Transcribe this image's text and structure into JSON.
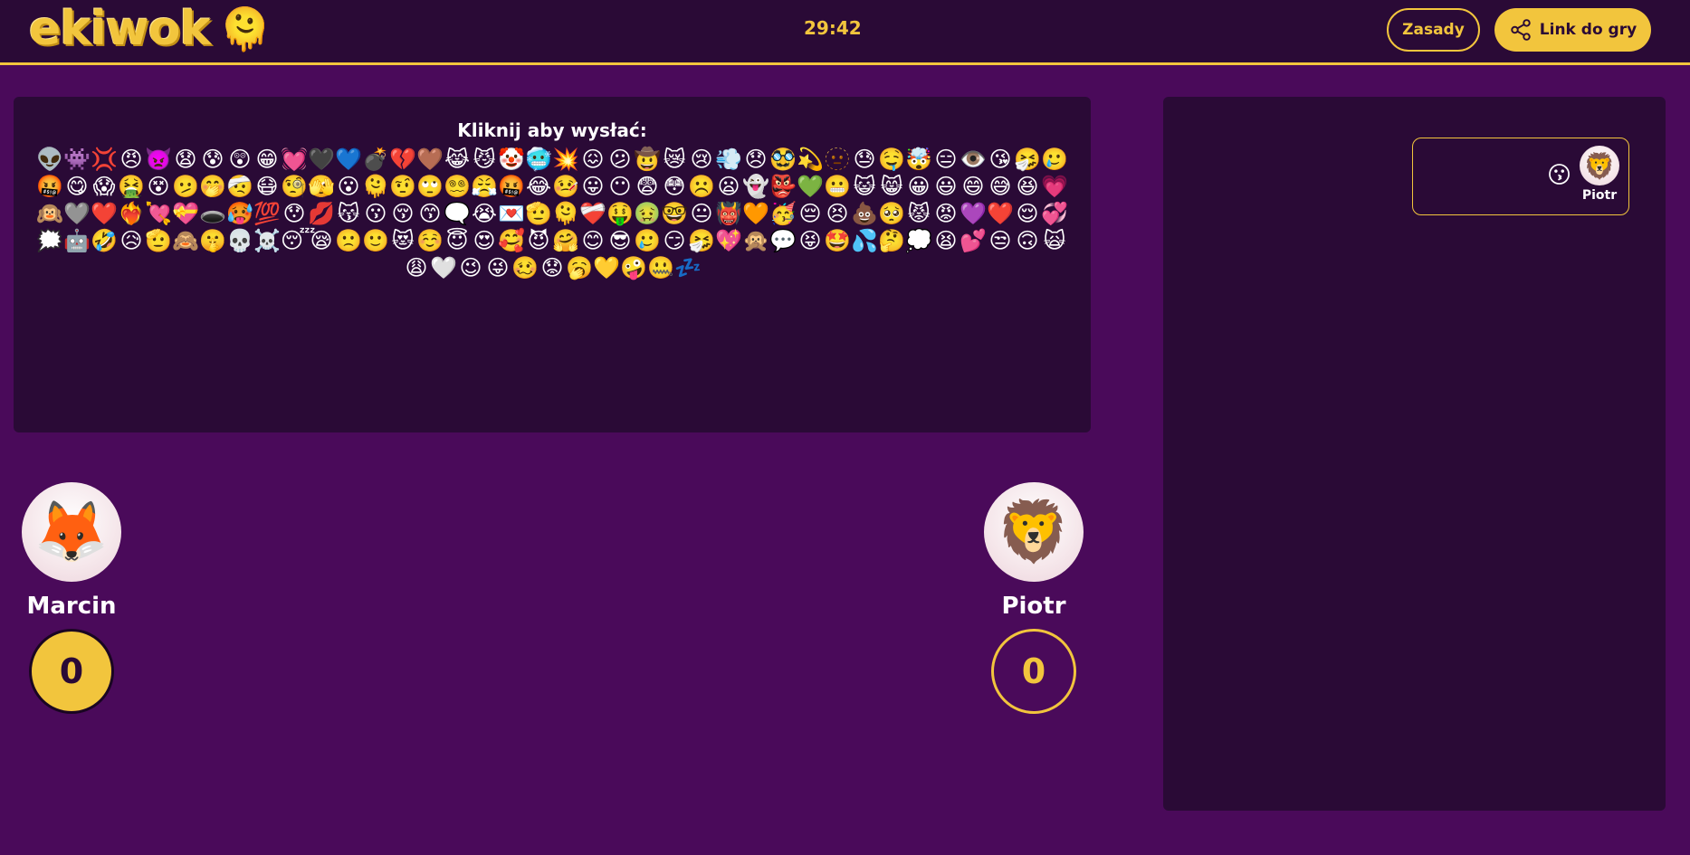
{
  "header": {
    "logo_text": "ekiwok",
    "logo_emoji": "🫠",
    "timer": "29:42",
    "rules_label": "Zasady",
    "link_label": "Link do gry",
    "link_icon": "share-icon"
  },
  "emoji_panel": {
    "title": "Kliknij aby wysłać:",
    "emojis": [
      "👽",
      "👾",
      "💢",
      "😠",
      "👿",
      "😧",
      "😰",
      "😲",
      "😁",
      "💓",
      "🖤",
      "💙",
      "💣",
      "💔",
      "🤎",
      "😹",
      "😼",
      "🤡",
      "🥶",
      "💥",
      "😖",
      "😕",
      "🤠",
      "😿",
      "😢",
      "💨",
      "😞",
      "🥸",
      "💫",
      "🫥",
      "😓",
      "🤤",
      "🤯",
      "😑",
      "👁️",
      "😘",
      "🤧",
      "🥲",
      "🤬",
      "😋",
      "😱",
      "🤮",
      "😵",
      "🫤",
      "🤭",
      "🤕",
      "😷",
      "🧐",
      "🫣",
      "😮",
      "🫠",
      "🤨",
      "🙄",
      "😵‍💫",
      "😤",
      "🤬",
      "😂",
      "🤒",
      "😛",
      "😶",
      "😨",
      "😳",
      "☹️",
      "😦",
      "👻",
      "👺",
      "💚",
      "😬",
      "😺",
      "😸",
      "😀",
      "😃",
      "😄",
      "😅",
      "😆",
      "💗",
      "🙉",
      "🩶",
      "❤️",
      "❤️‍🔥",
      "💘",
      "💝",
      "🕳️",
      "🥵",
      "💯",
      "😯",
      "💋",
      "😽",
      "😗",
      "😚",
      "😙",
      "🗨️",
      "😭",
      "💌",
      "🫡",
      "🫠",
      "❤️‍🩹",
      "🤑",
      "🤢",
      "🤓",
      "😐",
      "👹",
      "🧡",
      "🥳",
      "😔",
      "😣",
      "💩",
      "🥺",
      "😾",
      "😡",
      "💜",
      "❤️",
      "😌",
      "💞",
      "🗯️",
      "🤖",
      "🤣",
      "😥",
      "🫡",
      "🙈",
      "🤫",
      "💀",
      "☠️",
      "😴",
      "😪",
      "🙁",
      "🙂",
      "😻",
      "☺️",
      "😇",
      "😍",
      "🥰",
      "😈",
      "🤗",
      "😊",
      "😎",
      "🥲",
      "😏",
      "🤧",
      "💖",
      "🙊",
      "💬",
      "😝",
      "🤩",
      "💦",
      "🤔",
      "💭",
      "😫",
      "💕",
      "😒",
      "🙃",
      "🙀",
      "😩",
      "🤍",
      "😉",
      "😜",
      "🥴",
      "😟",
      "🥱",
      "💛",
      "🤪",
      "🤐",
      "💤"
    ]
  },
  "players": [
    {
      "name": "Marcin",
      "avatar": "🦊",
      "score": "0"
    },
    {
      "name": "Piotr",
      "avatar": "🦁",
      "score": "0"
    }
  ],
  "chat": {
    "messages": [
      {
        "name": "Piotr",
        "avatar": "🦁",
        "emoji": "😗"
      }
    ]
  },
  "colors": {
    "background": "#4a0a5a",
    "panel": "#2a0a36",
    "accent": "#f2c53d"
  }
}
